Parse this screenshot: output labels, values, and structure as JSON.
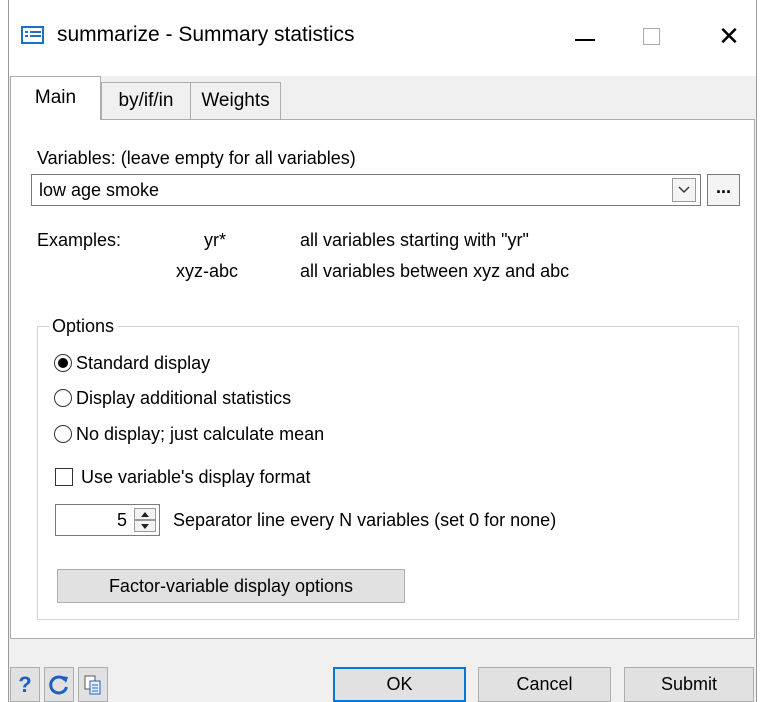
{
  "window": {
    "title": "summarize - Summary statistics",
    "controls": {
      "minimize": "minimize-icon",
      "maximize": "maximize-icon",
      "close": "close-icon"
    }
  },
  "tabs": [
    {
      "label": "Main",
      "selected": true
    },
    {
      "label": "by/if/in",
      "selected": false
    },
    {
      "label": "Weights",
      "selected": false
    }
  ],
  "variables": {
    "label": "Variables: (leave empty for all variables)",
    "value": "low age smoke",
    "browse_label": "..."
  },
  "examples": {
    "label": "Examples:",
    "rows": [
      {
        "pattern": "yr*",
        "description": "all variables starting with \"yr\""
      },
      {
        "pattern": "xyz-abc",
        "description": "all variables between xyz and abc"
      }
    ]
  },
  "options": {
    "legend": "Options",
    "display_modes": [
      {
        "label": "Standard display",
        "selected": true
      },
      {
        "label": "Display additional statistics",
        "selected": false
      },
      {
        "label": "No display; just calculate mean",
        "selected": false
      }
    ],
    "format_checkbox": {
      "label": "Use variable's display format",
      "checked": false
    },
    "separator": {
      "value": "5",
      "label": "Separator line every N variables (set 0 for none)"
    },
    "factor_button": "Factor-variable display options"
  },
  "footer": {
    "help_label": "?",
    "ok": "OK",
    "cancel": "Cancel",
    "submit": "Submit"
  },
  "colors": {
    "accent": "#0078d7",
    "icon_blue": "#1f6fc7"
  }
}
